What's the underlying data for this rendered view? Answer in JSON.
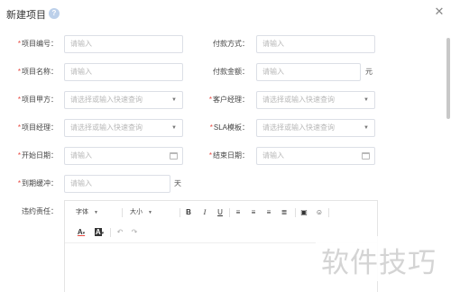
{
  "dialog": {
    "title": "新建项目",
    "help_icon": "question-circle-icon",
    "close_icon": "close-icon"
  },
  "form": {
    "project_code": {
      "label": "项目编号：",
      "required": true,
      "placeholder": "请输入"
    },
    "payment_method": {
      "label": "付款方式：",
      "required": false,
      "placeholder": "请输入"
    },
    "project_name": {
      "label": "项目名称：",
      "required": true,
      "placeholder": "请输入"
    },
    "payment_amount": {
      "label": "付款金额：",
      "required": false,
      "placeholder": "请输入",
      "suffix": "元"
    },
    "project_party_a": {
      "label": "项目甲方：",
      "required": true,
      "placeholder": "请选择或输入快速查询"
    },
    "customer_manager": {
      "label": "客户经理：",
      "required": true,
      "placeholder": "请选择或输入快速查询"
    },
    "project_manager": {
      "label": "项目经理：",
      "required": true,
      "placeholder": "请选择或输入快速查询"
    },
    "sla_template": {
      "label": "SLA模板：",
      "required": true,
      "placeholder": "请选择或输入快速查询"
    },
    "start_date": {
      "label": "开始日期：",
      "required": true,
      "placeholder": "请输入"
    },
    "end_date": {
      "label": "结束日期：",
      "required": true,
      "placeholder": "请输入"
    },
    "expiry_buffer": {
      "label": "到期缓冲：",
      "required": true,
      "placeholder": "请输入",
      "suffix": "天"
    },
    "breach_liability": {
      "label": "违约责任：",
      "required": false
    }
  },
  "editor": {
    "font_family": "字体",
    "font_size": "大小",
    "bold": "B",
    "italic": "I",
    "underline": "U",
    "font_color": "A",
    "bg_color": "A"
  },
  "watermark": "软件技巧"
}
